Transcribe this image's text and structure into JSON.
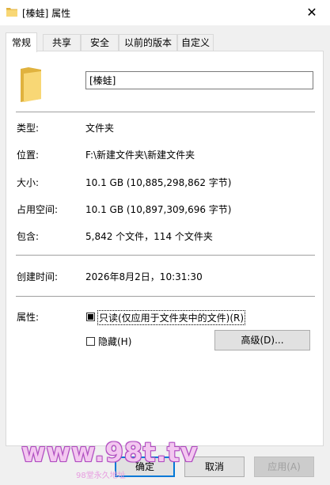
{
  "window": {
    "title": "[榛蛙] 属性",
    "close_glyph": "✕"
  },
  "tabs": [
    {
      "label": "常规",
      "active": true
    },
    {
      "label": "共享",
      "active": false
    },
    {
      "label": "安全",
      "active": false
    },
    {
      "label": "以前的版本",
      "active": false
    },
    {
      "label": "自定义",
      "active": false
    }
  ],
  "general": {
    "folder_name": "[榛蛙]",
    "rows": {
      "type": {
        "label": "类型:",
        "value": "文件夹"
      },
      "location": {
        "label": "位置:",
        "value": "F:\\新建文件夹\\新建文件夹"
      },
      "size": {
        "label": "大小:",
        "value": "10.1 GB (10,885,298,862 字节)"
      },
      "size_on_disk": {
        "label": "占用空间:",
        "value": "10.1 GB (10,897,309,696 字节)"
      },
      "contains": {
        "label": "包含:",
        "value": "5,842 个文件，114 个文件夹"
      },
      "created": {
        "label": "创建时间:",
        "value": "2026年8月2日，10:31:30"
      }
    },
    "attributes": {
      "label": "属性:",
      "readonly_label": "只读(仅应用于文件夹中的文件)(R)",
      "readonly_state": "indeterminate",
      "hidden_label": "隐藏(H)",
      "hidden_checked": false,
      "advanced_label": "高级(D)..."
    }
  },
  "footer": {
    "ok_label": "确定",
    "cancel_label": "取消",
    "apply_label": "应用(A)"
  },
  "watermark": {
    "text": "www.98t.tv",
    "subtext": "98堂永久地址"
  },
  "colors": {
    "accent": "#0078d7",
    "folder": "#f8d775",
    "folder_dark": "#e0b23e",
    "watermark": "#f3c7f0"
  }
}
